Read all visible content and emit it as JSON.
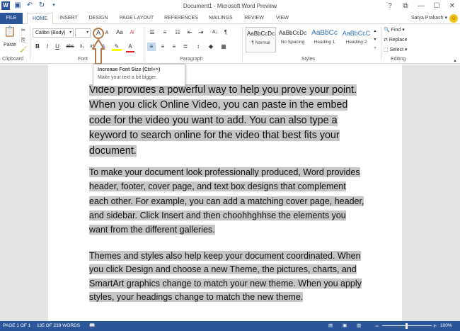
{
  "window": {
    "title": "Document1 - Microsoft Word Preview",
    "controls": [
      "?",
      "⧉",
      "—",
      "☐",
      "✕"
    ]
  },
  "qat": {
    "icons": [
      "word-icon",
      "save-icon",
      "undo-icon",
      "redo-icon",
      "customize-icon"
    ]
  },
  "tabs": [
    {
      "label": "FILE"
    },
    {
      "label": "HOME"
    },
    {
      "label": "INSERT"
    },
    {
      "label": "DESIGN"
    },
    {
      "label": "PAGE LAYOUT"
    },
    {
      "label": "REFERENCES"
    },
    {
      "label": "MAILINGS"
    },
    {
      "label": "REVIEW"
    },
    {
      "label": "VIEW"
    }
  ],
  "user": {
    "name": "Satya Prakash ▾"
  },
  "ribbon": {
    "clipboard": {
      "paste": "Paste",
      "label": "Clipboard"
    },
    "font": {
      "family": "Calibri (Body)",
      "size": "",
      "label": "Font",
      "grow": "A",
      "shrink": "A",
      "case": "Aa",
      "bold": "B",
      "italic": "I",
      "underline": "U",
      "strike": "abc",
      "subscript": "x₂",
      "superscript": "x²",
      "font_color": "A"
    },
    "paragraph": {
      "label": "Paragraph",
      "pilcrow": "¶"
    },
    "styles": {
      "label": "Styles",
      "items": [
        {
          "preview": "AaBbCcDc",
          "name": "¶ Normal"
        },
        {
          "preview": "AaBbCcDc",
          "name": "No Spacing"
        },
        {
          "preview": "AaBbCc",
          "name": "Heading 1"
        },
        {
          "preview": "AaBbCcC",
          "name": "Heading 2"
        }
      ]
    },
    "editing": {
      "label": "Editing",
      "find": "Find ▾",
      "replace": "Replace",
      "select": "Select ▾"
    }
  },
  "tooltip": {
    "title": "Increase Font Size (Ctrl+>)",
    "description": "Make your text a bit bigger."
  },
  "document": {
    "paragraphs": [
      "Video provides a powerful way to help you prove your point. When you click Online Video, you can paste in the embed code for the video you want to add. You can also type a keyword to search online for the video that best fits your document.",
      "To make your document look professionally produced, Word provides header, footer, cover page, and text box designs that complement each other. For example, you can add a matching cover page, header, and sidebar. Click Insert and then choohhghhse the elements you want from the different galleries.",
      "Themes and styles also help keep your document coordinated. When you click Design and choose a new Theme, the pictures, charts, and SmartArt graphics change to match your new theme. When you apply styles, your headings change to match the new theme."
    ]
  },
  "status": {
    "page": "PAGE 1 OF 1",
    "words": "135 OF 239 WORDS",
    "zoom_minus": "−",
    "zoom_plus": "+",
    "zoom": "100%"
  },
  "colors": {
    "accent": "#2b579a",
    "selection": "#c6c6c6",
    "annotation": "#b5754a"
  }
}
